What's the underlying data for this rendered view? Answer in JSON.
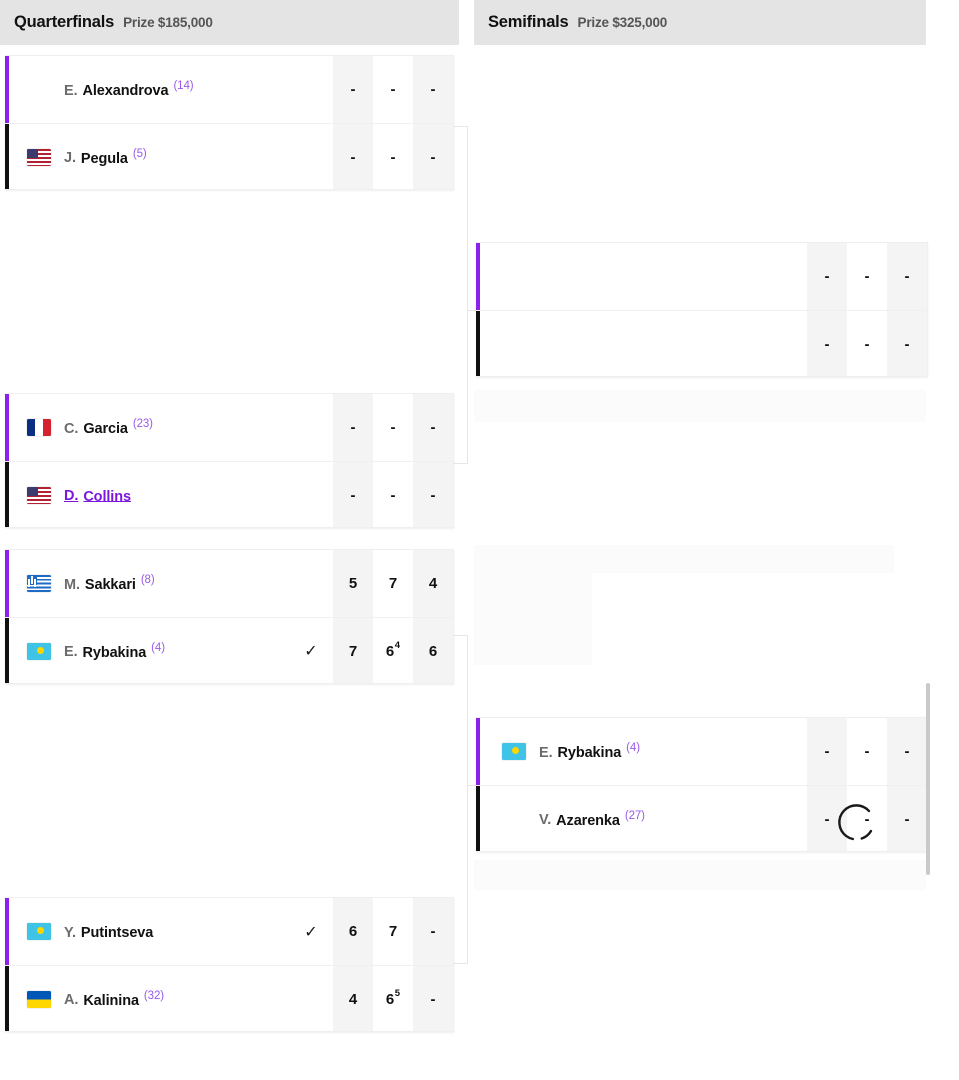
{
  "rounds": [
    {
      "id": "quarterfinals",
      "title": "Quarterfinals",
      "prize": "Prize $185,000",
      "matches": [
        {
          "id": "qf1",
          "players": [
            {
              "initial": "E.",
              "surname": "Alexandrova",
              "seed": "(14)",
              "flag": "none",
              "winner": false,
              "link": false,
              "scores": [
                "-",
                "-",
                "-"
              ]
            },
            {
              "initial": "J.",
              "surname": "Pegula",
              "seed": "(5)",
              "flag": "us",
              "winner": false,
              "link": false,
              "scores": [
                "-",
                "-",
                "-"
              ]
            }
          ]
        },
        {
          "id": "qf2",
          "players": [
            {
              "initial": "C.",
              "surname": "Garcia",
              "seed": "(23)",
              "flag": "fr",
              "winner": false,
              "link": false,
              "scores": [
                "-",
                "-",
                "-"
              ]
            },
            {
              "initial": "D.",
              "surname": "Collins",
              "seed": "",
              "flag": "us",
              "winner": false,
              "link": true,
              "scores": [
                "-",
                "-",
                "-"
              ]
            }
          ]
        },
        {
          "id": "qf3",
          "players": [
            {
              "initial": "M.",
              "surname": "Sakkari",
              "seed": "(8)",
              "flag": "gr",
              "winner": false,
              "link": false,
              "scores": [
                "5",
                "7",
                "4"
              ],
              "tiebreaks": [
                "",
                "",
                ""
              ]
            },
            {
              "initial": "E.",
              "surname": "Rybakina",
              "seed": "(4)",
              "flag": "kz",
              "winner": true,
              "link": false,
              "scores": [
                "7",
                "6",
                "6"
              ],
              "tiebreaks": [
                "",
                "4",
                ""
              ]
            }
          ]
        },
        {
          "id": "qf4",
          "players": [
            {
              "initial": "Y.",
              "surname": "Putintseva",
              "seed": "",
              "flag": "kz",
              "winner": true,
              "link": false,
              "scores": [
                "6",
                "7",
                "-"
              ],
              "tiebreaks": [
                "",
                "",
                ""
              ]
            },
            {
              "initial": "A.",
              "surname": "Kalinina",
              "seed": "(32)",
              "flag": "ua",
              "winner": false,
              "link": false,
              "scores": [
                "4",
                "6",
                "-"
              ],
              "tiebreaks": [
                "",
                "5",
                ""
              ]
            }
          ]
        }
      ]
    },
    {
      "id": "semifinals",
      "title": "Semifinals",
      "prize": "Prize $325,000",
      "matches": [
        {
          "id": "sf1",
          "players": [
            {
              "initial": "",
              "surname": "",
              "seed": "",
              "flag": "none",
              "winner": false,
              "link": false,
              "scores": [
                "-",
                "-",
                "-"
              ]
            },
            {
              "initial": "",
              "surname": "",
              "seed": "",
              "flag": "none",
              "winner": false,
              "link": false,
              "scores": [
                "-",
                "-",
                "-"
              ]
            }
          ]
        },
        {
          "id": "sf2",
          "players": [
            {
              "initial": "E.",
              "surname": "Rybakina",
              "seed": "(4)",
              "flag": "kz",
              "winner": false,
              "link": false,
              "scores": [
                "-",
                "-",
                "-"
              ]
            },
            {
              "initial": "V.",
              "surname": "Azarenka",
              "seed": "(27)",
              "flag": "none",
              "winner": false,
              "link": false,
              "scores": [
                "-",
                "-",
                "-"
              ]
            }
          ]
        }
      ]
    }
  ],
  "icons": {
    "winner_check": "✓"
  },
  "colors": {
    "accent_purple": "#8a22ec",
    "accent_black": "#101010",
    "seed_purple": "#9a5ae8",
    "link_purple": "#7b16e0",
    "header_bg": "#e4e4e4"
  },
  "overlay": {
    "spinner_label": "loading-spinner",
    "scrollbar_label": "vertical-scrollbar"
  }
}
